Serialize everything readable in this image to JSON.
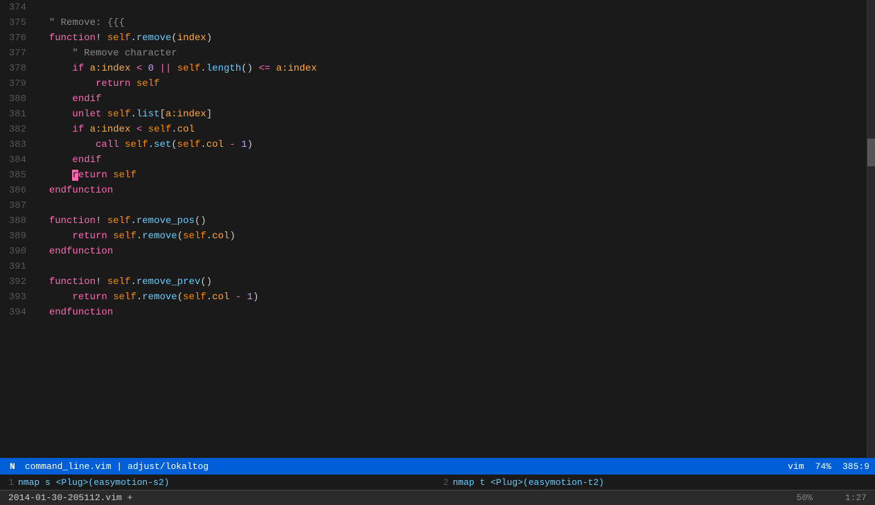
{
  "editor": {
    "background": "#1a1a1a",
    "lines": [
      {
        "num": "374",
        "tokens": [
          {
            "text": "",
            "class": ""
          }
        ]
      },
      {
        "num": "375",
        "tokens": [
          {
            "text": "  ",
            "class": "c-text"
          },
          {
            "text": "\" Remove: {{{",
            "class": "c-comment"
          }
        ]
      },
      {
        "num": "376",
        "tokens": [
          {
            "text": "  ",
            "class": "c-text"
          },
          {
            "text": "function",
            "class": "c-keyword-fn"
          },
          {
            "text": "! ",
            "class": "c-text"
          },
          {
            "text": "self",
            "class": "c-self"
          },
          {
            "text": ".",
            "class": "c-dot"
          },
          {
            "text": "remove",
            "class": "c-method"
          },
          {
            "text": "(",
            "class": "c-paren"
          },
          {
            "text": "index",
            "class": "c-param"
          },
          {
            "text": ")",
            "class": "c-paren"
          }
        ]
      },
      {
        "num": "377",
        "tokens": [
          {
            "text": "      ",
            "class": "c-text"
          },
          {
            "text": "\" Remove character",
            "class": "c-comment"
          }
        ]
      },
      {
        "num": "378",
        "tokens": [
          {
            "text": "      ",
            "class": "c-text"
          },
          {
            "text": "if",
            "class": "c-if"
          },
          {
            "text": " ",
            "class": "c-text"
          },
          {
            "text": "a:index",
            "class": "c-param"
          },
          {
            "text": " < ",
            "class": "c-operator"
          },
          {
            "text": "0",
            "class": "c-number"
          },
          {
            "text": " || ",
            "class": "c-operator"
          },
          {
            "text": "self",
            "class": "c-self"
          },
          {
            "text": ".",
            "class": "c-dot"
          },
          {
            "text": "length",
            "class": "c-method"
          },
          {
            "text": "()",
            "class": "c-paren"
          },
          {
            "text": " <= ",
            "class": "c-operator"
          },
          {
            "text": "a:index",
            "class": "c-param"
          }
        ]
      },
      {
        "num": "379",
        "tokens": [
          {
            "text": "          ",
            "class": "c-text"
          },
          {
            "text": "return",
            "class": "c-return-kw"
          },
          {
            "text": " ",
            "class": "c-text"
          },
          {
            "text": "self",
            "class": "c-self"
          }
        ]
      },
      {
        "num": "380",
        "tokens": [
          {
            "text": "      ",
            "class": "c-text"
          },
          {
            "text": "endif",
            "class": "c-endif"
          }
        ]
      },
      {
        "num": "381",
        "tokens": [
          {
            "text": "      ",
            "class": "c-text"
          },
          {
            "text": "unlet",
            "class": "c-unlet"
          },
          {
            "text": " ",
            "class": "c-text"
          },
          {
            "text": "self",
            "class": "c-self"
          },
          {
            "text": ".",
            "class": "c-dot"
          },
          {
            "text": "list",
            "class": "c-method"
          },
          {
            "text": "[",
            "class": "c-bracket"
          },
          {
            "text": "a:index",
            "class": "c-param"
          },
          {
            "text": "]",
            "class": "c-bracket"
          }
        ]
      },
      {
        "num": "382",
        "tokens": [
          {
            "text": "      ",
            "class": "c-text"
          },
          {
            "text": "if",
            "class": "c-if"
          },
          {
            "text": " ",
            "class": "c-text"
          },
          {
            "text": "a:index",
            "class": "c-param"
          },
          {
            "text": " < ",
            "class": "c-operator"
          },
          {
            "text": "self",
            "class": "c-self"
          },
          {
            "text": ".",
            "class": "c-dot"
          },
          {
            "text": "col",
            "class": "c-col"
          }
        ]
      },
      {
        "num": "383",
        "tokens": [
          {
            "text": "          ",
            "class": "c-text"
          },
          {
            "text": "call",
            "class": "c-call"
          },
          {
            "text": " ",
            "class": "c-text"
          },
          {
            "text": "self",
            "class": "c-self"
          },
          {
            "text": ".",
            "class": "c-dot"
          },
          {
            "text": "set",
            "class": "c-method"
          },
          {
            "text": "(",
            "class": "c-paren"
          },
          {
            "text": "self",
            "class": "c-self"
          },
          {
            "text": ".",
            "class": "c-dot"
          },
          {
            "text": "col",
            "class": "c-col"
          },
          {
            "text": " - ",
            "class": "c-operator"
          },
          {
            "text": "1",
            "class": "c-number"
          },
          {
            "text": ")",
            "class": "c-paren"
          }
        ]
      },
      {
        "num": "384",
        "tokens": [
          {
            "text": "      ",
            "class": "c-text"
          },
          {
            "text": "endif",
            "class": "c-endif"
          }
        ]
      },
      {
        "num": "385",
        "tokens": [
          {
            "text": "      ",
            "class": "c-text"
          },
          {
            "text": "r",
            "class": "c-cursor"
          },
          {
            "text": "eturn",
            "class": "c-return-kw"
          },
          {
            "text": " ",
            "class": "c-text"
          },
          {
            "text": "self",
            "class": "c-self"
          }
        ]
      },
      {
        "num": "386",
        "tokens": [
          {
            "text": "  ",
            "class": "c-text"
          },
          {
            "text": "endfunction",
            "class": "c-endfunction"
          }
        ]
      },
      {
        "num": "387",
        "tokens": [
          {
            "text": "",
            "class": ""
          }
        ]
      },
      {
        "num": "388",
        "tokens": [
          {
            "text": "  ",
            "class": "c-text"
          },
          {
            "text": "function",
            "class": "c-keyword-fn"
          },
          {
            "text": "! ",
            "class": "c-text"
          },
          {
            "text": "self",
            "class": "c-self"
          },
          {
            "text": ".",
            "class": "c-dot"
          },
          {
            "text": "remove_pos",
            "class": "c-method"
          },
          {
            "text": "()",
            "class": "c-paren"
          }
        ]
      },
      {
        "num": "389",
        "tokens": [
          {
            "text": "      ",
            "class": "c-text"
          },
          {
            "text": "return",
            "class": "c-return-kw"
          },
          {
            "text": " ",
            "class": "c-text"
          },
          {
            "text": "self",
            "class": "c-self"
          },
          {
            "text": ".",
            "class": "c-dot"
          },
          {
            "text": "remove",
            "class": "c-method"
          },
          {
            "text": "(",
            "class": "c-paren"
          },
          {
            "text": "self",
            "class": "c-self"
          },
          {
            "text": ".",
            "class": "c-dot"
          },
          {
            "text": "col",
            "class": "c-col"
          },
          {
            "text": ")",
            "class": "c-paren"
          }
        ]
      },
      {
        "num": "390",
        "tokens": [
          {
            "text": "  ",
            "class": "c-text"
          },
          {
            "text": "endfunction",
            "class": "c-endfunction"
          }
        ]
      },
      {
        "num": "391",
        "tokens": [
          {
            "text": "",
            "class": ""
          }
        ]
      },
      {
        "num": "392",
        "tokens": [
          {
            "text": "  ",
            "class": "c-text"
          },
          {
            "text": "function",
            "class": "c-keyword-fn"
          },
          {
            "text": "! ",
            "class": "c-text"
          },
          {
            "text": "self",
            "class": "c-self"
          },
          {
            "text": ".",
            "class": "c-dot"
          },
          {
            "text": "remove_prev",
            "class": "c-method"
          },
          {
            "text": "()",
            "class": "c-paren"
          }
        ]
      },
      {
        "num": "393",
        "tokens": [
          {
            "text": "      ",
            "class": "c-text"
          },
          {
            "text": "return",
            "class": "c-return-kw"
          },
          {
            "text": " ",
            "class": "c-text"
          },
          {
            "text": "self",
            "class": "c-self"
          },
          {
            "text": ".",
            "class": "c-dot"
          },
          {
            "text": "remove",
            "class": "c-method"
          },
          {
            "text": "(",
            "class": "c-paren"
          },
          {
            "text": "self",
            "class": "c-self"
          },
          {
            "text": ".",
            "class": "c-dot"
          },
          {
            "text": "col",
            "class": "c-col"
          },
          {
            "text": " - ",
            "class": "c-operator"
          },
          {
            "text": "1",
            "class": "c-number"
          },
          {
            "text": ")",
            "class": "c-paren"
          }
        ]
      },
      {
        "num": "394",
        "tokens": [
          {
            "text": "  ",
            "class": "c-text"
          },
          {
            "text": "endfunction",
            "class": "c-endfunction"
          }
        ]
      }
    ]
  },
  "status_bar": {
    "mode": "N",
    "file": "command_line.vim  |  adjust/lokaltog",
    "filetype": "vim",
    "percent": "74%",
    "position": "385:9"
  },
  "command_lines": [
    {
      "num": "1",
      "content": "nmap s <Plug>(easymotion-s2)"
    },
    {
      "num": "2",
      "content": "nmap t <Plug>(easymotion-t2)"
    }
  ],
  "tab_bar": {
    "file": "2014-01-30-205112.vim +",
    "percent": "50%",
    "position": "1:27"
  }
}
